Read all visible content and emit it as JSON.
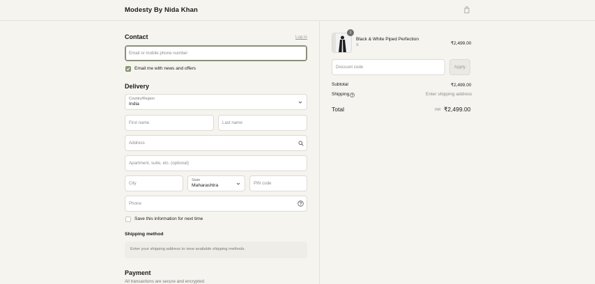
{
  "header": {
    "brand": "Modesty By Nida Khan",
    "cart_icon": "shopping-bag-icon"
  },
  "contact": {
    "heading": "Contact",
    "login_link": "Log in",
    "email_placeholder": "Email or mobile phone number",
    "news_checkbox_label": "Email me with news and offers",
    "news_checked": true
  },
  "delivery": {
    "heading": "Delivery",
    "country_label": "Country/Region",
    "country_value": "India",
    "first_name_placeholder": "First name",
    "last_name_placeholder": "Last name",
    "address_placeholder": "Address",
    "apartment_placeholder": "Apartment, suite, etc. (optional)",
    "city_placeholder": "City",
    "state_label": "State",
    "state_value": "Maharashtra",
    "pin_placeholder": "PIN code",
    "phone_placeholder": "Phone",
    "save_info_label": "Save this information for next time",
    "save_info_checked": false
  },
  "shipping_method": {
    "heading": "Shipping method",
    "notice": "Enter your shipping address to view available shipping methods."
  },
  "payment": {
    "heading": "Payment",
    "subtitle": "All transactions are secure and encrypted."
  },
  "summary": {
    "item": {
      "name": "Black & White Piped Perfection",
      "variant": "S",
      "price": "₹2,499.00",
      "quantity": "1"
    },
    "discount_placeholder": "Discount code",
    "apply_label": "Apply",
    "subtotal_label": "Subtotal",
    "subtotal_value": "₹2,499.00",
    "shipping_label": "Shipping",
    "shipping_value": "Enter shipping address",
    "total_label": "Total",
    "currency": "INR",
    "total_value": "₹2,499.00"
  },
  "colors": {
    "background": "#f6f4ef",
    "accent": "#8a9a7a",
    "border": "#dcdad5"
  }
}
